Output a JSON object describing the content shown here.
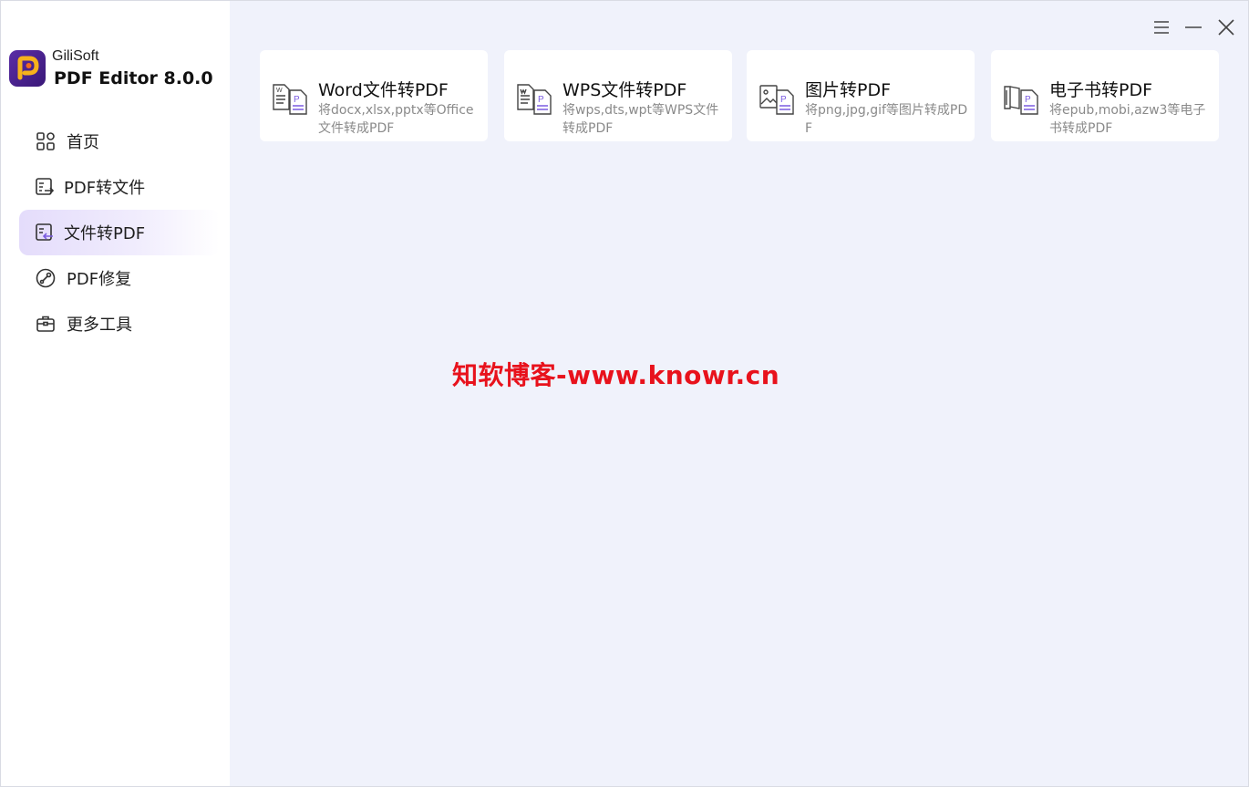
{
  "app": {
    "brand_sub": "GiliSoft",
    "brand_title": "PDF Editor 8.0.0"
  },
  "sidebar": {
    "items": [
      {
        "label": "首页",
        "icon": "home-grid-icon",
        "active": false
      },
      {
        "label": "PDF转文件",
        "icon": "pdf-to-file-icon",
        "active": false
      },
      {
        "label": "文件转PDF",
        "icon": "file-to-pdf-icon",
        "active": true
      },
      {
        "label": "PDF修复",
        "icon": "repair-icon",
        "active": false
      },
      {
        "label": "更多工具",
        "icon": "toolbox-icon",
        "active": false
      }
    ]
  },
  "window_controls": [
    "menu-icon",
    "minimize-icon",
    "close-icon"
  ],
  "cards": [
    {
      "title": "Word文件转PDF",
      "desc": "将docx,xlsx,pptx等Office文件转成PDF",
      "icon": "word-to-pdf-icon"
    },
    {
      "title": "WPS文件转PDF",
      "desc": "将wps,dts,wpt等WPS文件转成PDF",
      "icon": "wps-to-pdf-icon"
    },
    {
      "title": "图片转PDF",
      "desc": "将png,jpg,gif等图片转成PDF",
      "icon": "image-to-pdf-icon"
    },
    {
      "title": "电子书转PDF",
      "desc": "将epub,mobi,azw3等电子书转成PDF",
      "icon": "ebook-to-pdf-icon"
    }
  ],
  "watermark": "知软博客-www.knowr.cn",
  "colors": {
    "accent": "#7b5ce0",
    "sidebar_active": "#e4dcfb",
    "content_bg": "#f0f2fb",
    "watermark": "#e8121c"
  }
}
